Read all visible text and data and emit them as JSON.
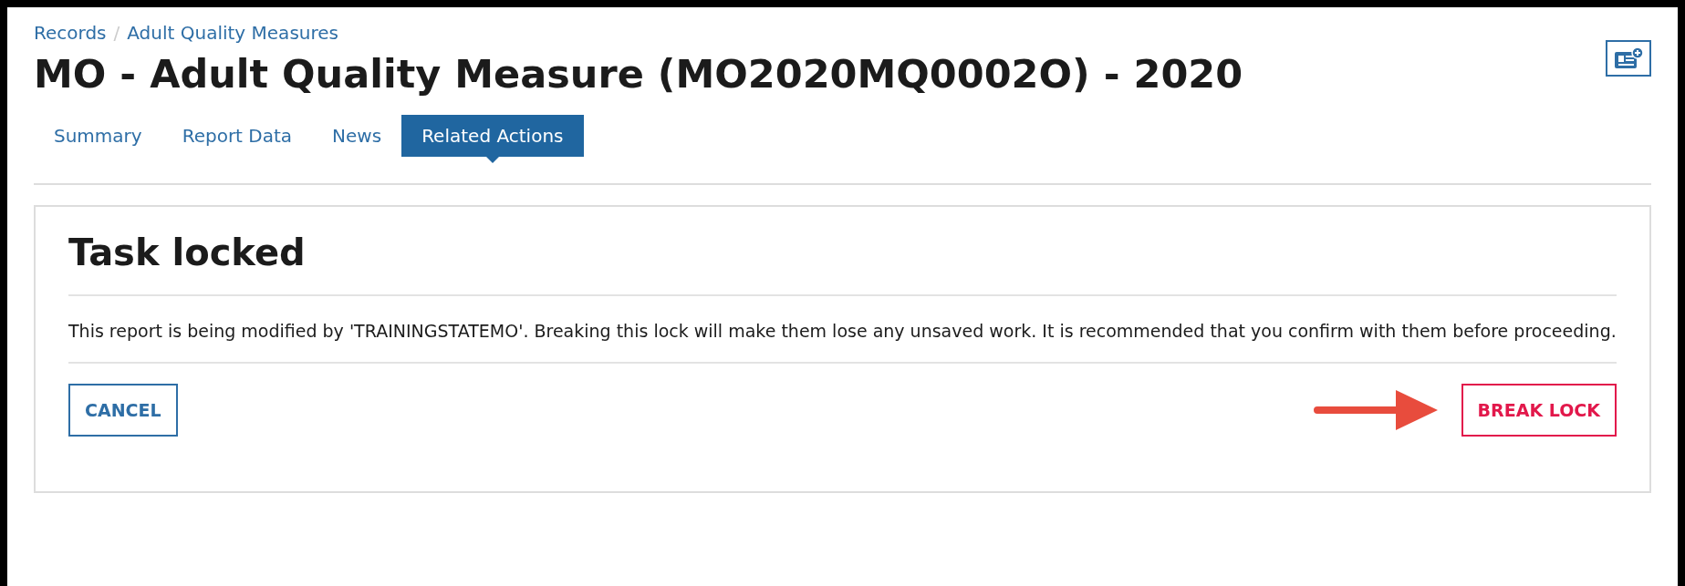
{
  "breadcrumb": [
    {
      "label": "Records"
    },
    {
      "label": "Adult Quality Measures"
    }
  ],
  "breadcrumb_separator": "/",
  "title": "MO - Adult Quality Measure (MO2020MQ0002O) - 2020",
  "tabs": [
    {
      "label": "Summary",
      "selected": false
    },
    {
      "label": "Report Data",
      "selected": false
    },
    {
      "label": "News",
      "selected": false
    },
    {
      "label": "Related Actions",
      "selected": true
    }
  ],
  "panel": {
    "heading": "Task locked",
    "message": "This report is being modified by 'TRAININGSTATEMO'. Breaking this lock will make them lose any unsaved work. It is recommended that you confirm with them before proceeding.",
    "buttons": [
      {
        "label": "CANCEL",
        "kind": "secondary"
      },
      {
        "label": "BREAK LOCK",
        "kind": "danger"
      }
    ]
  }
}
